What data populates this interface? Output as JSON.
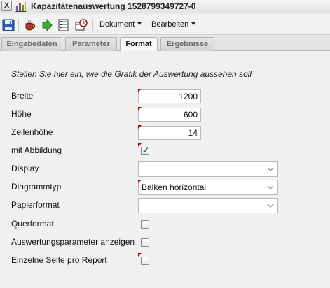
{
  "window": {
    "title": "Kapazitätenauswertung 1528799349727-0",
    "close_glyph": "X"
  },
  "toolbar": {
    "buttons": [
      {
        "icon": "save-icon"
      },
      {
        "icon": "coffee-cup-icon"
      },
      {
        "icon": "run-arrow-icon"
      },
      {
        "icon": "report-list-icon"
      },
      {
        "icon": "schedule-clock-icon"
      }
    ],
    "menus": [
      {
        "label": "Dokument"
      },
      {
        "label": "Bearbeiten"
      }
    ]
  },
  "tabs": [
    {
      "label": "Eingabedaten",
      "active": false
    },
    {
      "label": "Parameter",
      "active": false
    },
    {
      "label": "Format",
      "active": true
    },
    {
      "label": "Ergebnisse",
      "active": false
    }
  ],
  "form": {
    "intro": "Stellen Sie hier ein, wie die Grafik der Auswertung aussehen soll",
    "breite": {
      "label": "Breite",
      "value": "1200"
    },
    "hoehe": {
      "label": "Höhe",
      "value": "600"
    },
    "zeilenhoehe": {
      "label": "Zeilenhöhe",
      "value": "14"
    },
    "mit_abbildung": {
      "label": "mit Abbildung",
      "checked": true,
      "tick": "✓"
    },
    "display": {
      "label": "Display",
      "value": ""
    },
    "diagrammtyp": {
      "label": "Diagrammtyp",
      "value": "Balken horizontal"
    },
    "papierformat": {
      "label": "Papierformat",
      "value": ""
    },
    "querformat": {
      "label": "Querformat",
      "checked": false
    },
    "auswertungsparameter": {
      "label": "Auswertungsparameter anzeigen",
      "checked": false
    },
    "einzelne_seite": {
      "label": "Einzelne Seite pro Report",
      "checked": false
    }
  },
  "colors": {
    "required_marker": "#c00000",
    "check_tick": "#2b4f9c"
  }
}
